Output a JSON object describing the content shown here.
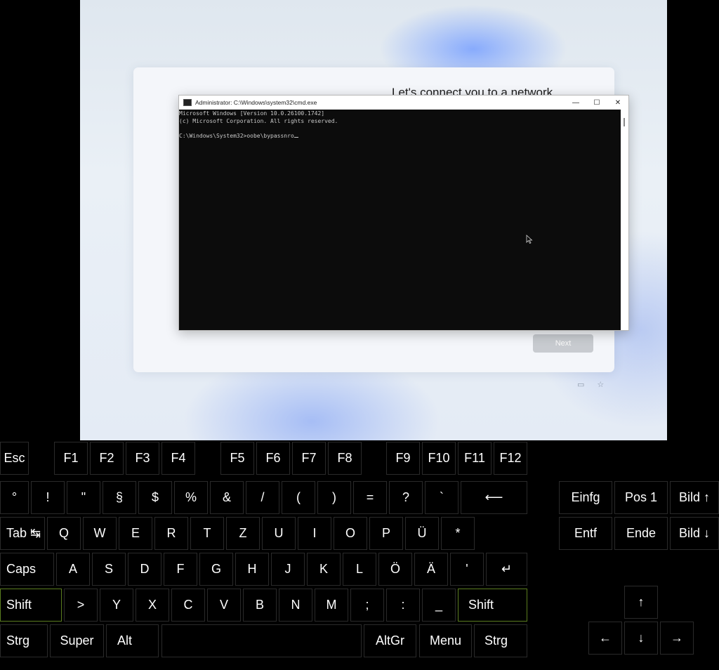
{
  "vm": {
    "oobe_title": "Let's connect you to a network",
    "next_label": "Next",
    "cmd": {
      "window_title": "Administrator: C:\\Windows\\system32\\cmd.exe",
      "icon_label": "C:\\",
      "minimize": "—",
      "maximize": "☐",
      "close": "✕",
      "line1": "Microsoft Windows [Version 10.0.26100.1742]",
      "line2": "(c) Microsoft Corporation. All rights reserved.",
      "prompt": "C:\\Windows\\System32>",
      "command": "oobe\\bypassnro"
    },
    "icons": [
      "keyboard-icon",
      "accessibility-icon"
    ]
  },
  "keyboard": {
    "esc": "Esc",
    "f1": "F1",
    "f2": "F2",
    "f3": "F3",
    "f4": "F4",
    "f5": "F5",
    "f6": "F6",
    "f7": "F7",
    "f8": "F8",
    "f9": "F9",
    "f10": "F10",
    "f11": "F11",
    "f12": "F12",
    "deg": "°",
    "excl": "!",
    "quote": "\"",
    "para": "§",
    "dollar": "$",
    "percent": "%",
    "amp": "&",
    "slash": "/",
    "lparen": "(",
    "rparen": ")",
    "equals": "=",
    "question": "?",
    "backtick": "`",
    "backspace": "⟵",
    "tab": "Tab ↹",
    "q": "Q",
    "w": "W",
    "e": "E",
    "r": "R",
    "t": "T",
    "z": "Z",
    "u": "U",
    "i": "I",
    "o": "O",
    "p": "P",
    "ue": "Ü",
    "star": "*",
    "caps": "Caps",
    "a": "A",
    "s": "S",
    "d": "D",
    "f": "F",
    "g": "G",
    "h": "H",
    "j": "J",
    "k": "K",
    "l": "L",
    "oe": "Ö",
    "ae": "Ä",
    "apos": "'",
    "enter": "↵",
    "shift_left": "Shift",
    "gt": ">",
    "y": "Y",
    "x": "X",
    "c": "C",
    "v": "V",
    "b": "B",
    "n": "N",
    "m": "M",
    "semicolon": ";",
    "colon": ":",
    "underscore": "_",
    "shift_right": "Shift",
    "strg_left": "Strg",
    "super": "Super",
    "alt": "Alt",
    "space": "",
    "altgr": "AltGr",
    "menu": "Menu",
    "strg_right": "Strg",
    "einfg": "Einfg",
    "pos1": "Pos 1",
    "bild_up": "Bild ↑",
    "entf": "Entf",
    "ende": "Ende",
    "bild_down": "Bild ↓",
    "arrow_up": "↑",
    "arrow_left": "←",
    "arrow_down": "↓",
    "arrow_right": "→"
  },
  "colors": {
    "shift_active_border": "#5b7e1f",
    "key_border": "#2a2a2a"
  }
}
